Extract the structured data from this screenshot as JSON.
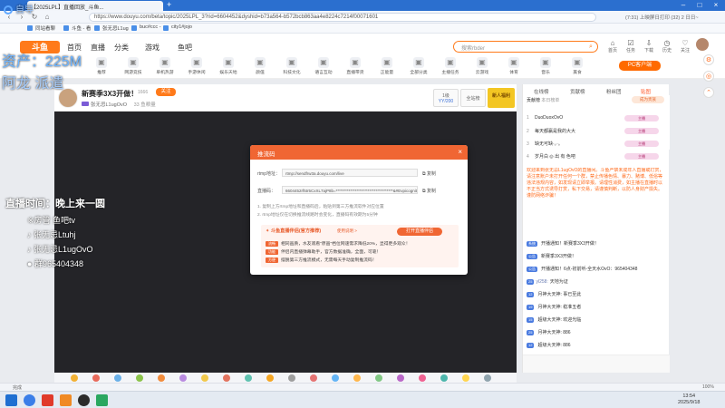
{
  "browser": {
    "tab_title": "【2025LPL】直播回放_斗鱼...",
    "url": "https://www.douyu.com/beta/topic/2025LPL_3?rid=6604452&dyshid=b73a564-b572bcb863aa4e8224c7214f00071601",
    "status_right": "(7:31) 上映屏日打印 (32) 2 日日~",
    "bookmarks": [
      "同站看聊",
      "斗鱼 - 看",
      "张无忌L1ug",
      "buc#ccc -",
      "city1#jojo"
    ]
  },
  "site": {
    "logo": "斗鱼",
    "nav": [
      "首页",
      "直播",
      "分类",
      "游戏",
      "鱼吧"
    ],
    "search_placeholder": "搜索rbder",
    "header_icons": [
      "首页",
      "任务",
      "下载",
      "历史",
      "关注",
      "主站"
    ],
    "categories": [
      "推荐",
      "网游竞技",
      "单机热游",
      "手游休闲",
      "娱乐天地",
      "颜值",
      "科技文化",
      "语言互动",
      "直播带货",
      "正能量",
      "全部分类",
      "主播任务",
      "云游戏",
      "体育",
      "音乐",
      "美食"
    ],
    "pc_button": "PC客户端"
  },
  "overlay": {
    "watermark1": "自导",
    "watermark2": "资产：225M",
    "watermark3": "阿龙 派遣",
    "schedule": "直播时间：晚上来一圆",
    "line1": "※房管 鱼吧tv",
    "line2": "张无忌Ltuhj",
    "line3": "张无忌L1ugOvO",
    "line4": "群965404348"
  },
  "room": {
    "title": "新赛季3X3开做！",
    "room_id": "1666",
    "follow": "关注",
    "streamer": "张无忌L1ugOvO",
    "meta": "33 鱼粮量",
    "box1_label": "1级",
    "box1_sub": "YY/200",
    "box2_label": "全站榜",
    "banner": "新人福利"
  },
  "modal": {
    "title": "推流码",
    "rtmp_label": "rtmp地址：",
    "rtmp_value": "rtmp://sendfrw3a.douyu.com/live",
    "key_label": "直播码：",
    "key_value": "6604452rf5tr5CxXL7ajP8b=************************************&#Evpicognition=0",
    "copy1": "复制",
    "copy2": "复制",
    "note1": "1. 复制上方rtmp地址和直播码后，粘贴到第三方推流软件对应位置",
    "note2": "2. rtmp地址仅在切换推流线路时会变化，直播码有效期为5分钟",
    "assistant_title": "斗鱼直播伴侣(官方推荐)",
    "assistant_link": "使用说明 >",
    "open_button": "打开直播伴侣",
    "tags": [
      "流畅",
      "功能",
      "方便"
    ],
    "features": [
      "相同画质，水友观看\"原画\"档位网速需求降低20%，显得更多观众！",
      "伴侣内直播弹幕助手，官方数据准确，全面，可靠！",
      "摆脱第三方推流模式，无需每天手动复制推流码！"
    ]
  },
  "chat": {
    "tabs": [
      "在线榜",
      "贡献榜",
      "粉丝团",
      "贴图"
    ],
    "rank_header": "贡献榜",
    "rank_sub": "本日榜单",
    "rank_action": "成为贵族",
    "rank": [
      {
        "n": "1",
        "name": "DuoDuoxOvO",
        "badge": "主播"
      },
      {
        "n": "2",
        "name": "每天都赢是我的大大",
        "badge": "主播"
      },
      {
        "n": "3",
        "name": "缺无可缺·。·。",
        "badge": "主播"
      },
      {
        "n": "4",
        "name": "岁月白 ◎ 出 有 色吧",
        "badge": "主播"
      }
    ],
    "notice": "欢迎来到张无忌L1ugOvO的直播间。斗鱼严禁未成年人直播或打赏，请注意账户未打开任何一个群，禁止传播色情、暴力、赌博、低俗等违法违规内容，如发现请立即举报。请理性消费，如主播在直播时以不正当方式诱导打赏，私下交易，请谨慎判断，以防人身财产损失。谨防网络诈骗！",
    "system": [
      {
        "lv": "系统",
        "name": "",
        "text": "开播通知！新赛季3X3开做！"
      },
      {
        "lv": "公告",
        "name": "",
        "text": "新赛季3X3开做！"
      },
      {
        "lv": "公告",
        "name": "",
        "text": "开播通知！6点-初前听-全天水OvO：965404348"
      },
      {
        "lv": "25",
        "name": "yl258:",
        "text": "天地为证"
      },
      {
        "lv": "12",
        "name": "",
        "text": "月神大天神: 事已至此"
      },
      {
        "lv": "19",
        "name": "",
        "text": "月神大天神: 稳准五者"
      },
      {
        "lv": "15",
        "name": "",
        "text": "超级大天神: 欢迎光临"
      },
      {
        "lv": "25",
        "name": "",
        "text": "月神大天神: 886"
      },
      {
        "lv": "12",
        "name": "",
        "text": "超级大天神: 886"
      }
    ]
  },
  "statusbar": {
    "left": "完成",
    "right": "100%"
  },
  "taskbar": {
    "time": "13:54",
    "date": "2025/9/18"
  }
}
